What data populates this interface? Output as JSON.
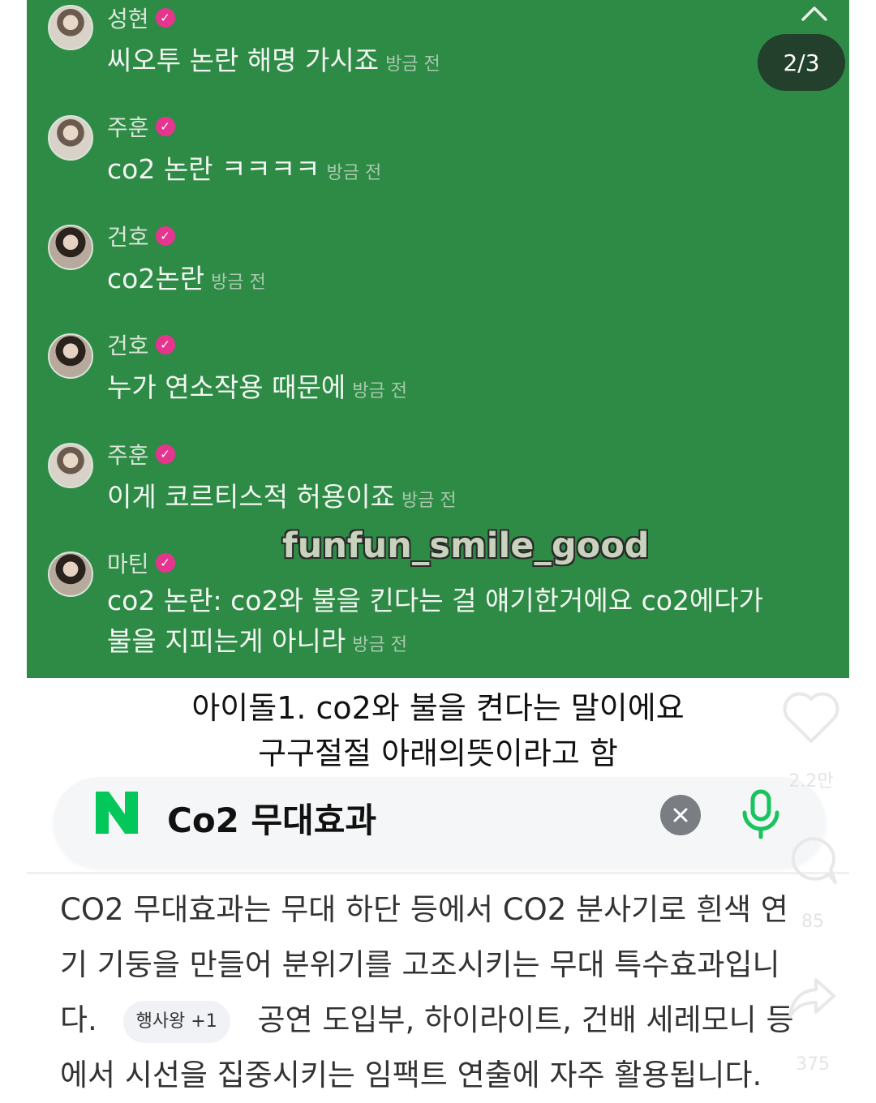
{
  "chat": {
    "page_indicator": "2/3",
    "watermark": "funfun_smile_good",
    "messages": [
      {
        "name": "성현",
        "text": "씨오투 논란 해명 가시죠",
        "time": "방금 전"
      },
      {
        "name": "주훈",
        "text": "co2 논란 ㅋㅋㅋㅋ",
        "time": "방금 전"
      },
      {
        "name": "건호",
        "text": "co2논란",
        "time": "방금 전"
      },
      {
        "name": "건호",
        "text": "누가 연소작용 때문에",
        "time": "방금 전"
      },
      {
        "name": "주훈",
        "text": "이게 코르티스적 허용이죠",
        "time": "방금 전"
      },
      {
        "name": "마틴",
        "text_line1": "co2 논란: co2와 불을 킨다는 걸 얘기한거에요 co2에다가",
        "text_line2": "불을 지피는게 아니라",
        "time": "방금 전"
      }
    ]
  },
  "caption": {
    "line1": "아이돌1. co2와 불을 켠다는 말이에요",
    "line2": "구구절절 아래의뜻이라고 함"
  },
  "search": {
    "logo_letter": "N",
    "query": "Co2 무대효과",
    "clear_icon": "close-x",
    "mic_icon": "microphone"
  },
  "result": {
    "text_part1": "CO2 무대효과는 무대 하단 등에서 CO2 분사기로 흰색 연기 기둥을 만들어 분위기를 고조시키는 무대 특수효과입니다.",
    "tag": "행사왕 +1",
    "text_part2": "공연 도입부, 하이라이트, 건배 세레모니 등에서 시선을 집중시키는 임팩트 연출에 자주 활용됩니다."
  },
  "side_actions": {
    "like_count": "2.2만",
    "comment_count": "85",
    "share_count": "375"
  },
  "colors": {
    "chat_bg": "#2e8b45",
    "verified": "#e6358f",
    "naver_green": "#03c75a"
  }
}
